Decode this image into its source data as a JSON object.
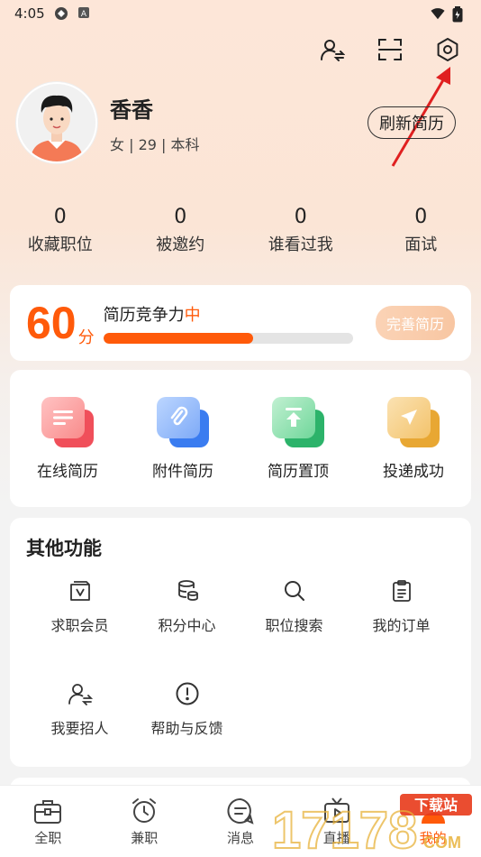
{
  "status_bar": {
    "time": "4:05"
  },
  "profile": {
    "name": "香香",
    "meta": "女 | 29 | 本科",
    "refresh_label": "刷新简历"
  },
  "stats": [
    {
      "value": "0",
      "label": "收藏职位"
    },
    {
      "value": "0",
      "label": "被邀约"
    },
    {
      "value": "0",
      "label": "谁看过我"
    },
    {
      "value": "0",
      "label": "面试"
    }
  ],
  "score": {
    "value": "60",
    "unit": "分",
    "title": "简历竞争力",
    "level": "中",
    "progress": 0.6,
    "improve_label": "完善简历"
  },
  "quick_actions": [
    {
      "label": "在线简历",
      "icon": "document-icon",
      "color": "#f46a6a"
    },
    {
      "label": "附件简历",
      "icon": "paperclip-icon",
      "color": "#4d8cf5"
    },
    {
      "label": "简历置顶",
      "icon": "upload-top-icon",
      "color": "#3ec27a"
    },
    {
      "label": "投递成功",
      "icon": "send-icon",
      "color": "#f0b84a"
    }
  ],
  "other_functions": {
    "title": "其他功能",
    "items": [
      {
        "label": "求职会员",
        "icon": "vip-bag-icon"
      },
      {
        "label": "积分中心",
        "icon": "coins-icon"
      },
      {
        "label": "职位搜索",
        "icon": "search-icon"
      },
      {
        "label": "我的订单",
        "icon": "clipboard-icon"
      },
      {
        "label": "我要招人",
        "icon": "recruit-icon"
      },
      {
        "label": "帮助与反馈",
        "icon": "exclamation-circle-icon"
      }
    ]
  },
  "bottom_nav": [
    {
      "label": "全职",
      "icon": "briefcase-icon"
    },
    {
      "label": "兼职",
      "icon": "alarm-clock-icon"
    },
    {
      "label": "消息",
      "icon": "chat-bubble-icon"
    },
    {
      "label": "直播",
      "icon": "tv-icon"
    },
    {
      "label": "我的",
      "icon": "user-icon",
      "active": true
    }
  ],
  "watermark": {
    "brand": "17178",
    "tag": "下载站",
    "suffix": "COM"
  },
  "colors": {
    "accent": "#ff5a0a",
    "arrow": "#e02020"
  }
}
